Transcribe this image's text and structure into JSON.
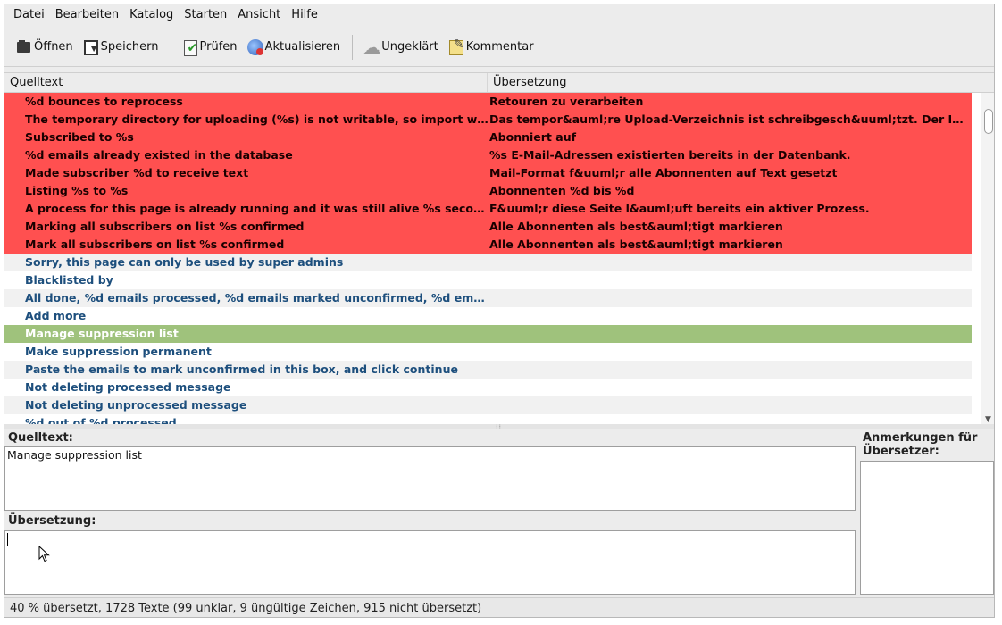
{
  "menubar": {
    "items": [
      "Datei",
      "Bearbeiten",
      "Katalog",
      "Starten",
      "Ansicht",
      "Hilfe"
    ]
  },
  "toolbar": {
    "open_label": "Öffnen",
    "save_label": "Speichern",
    "check_label": "Prüfen",
    "update_label": "Aktualisieren",
    "fuzzy_label": "Ungeklärt",
    "comment_label": "Kommentar"
  },
  "table": {
    "headers": [
      "Quelltext",
      "Übersetzung"
    ],
    "rows": [
      {
        "source": "%d bounces to reprocess",
        "translation": "Retouren zu verarbeiten",
        "state": "red"
      },
      {
        "source": "The temporary directory for uploading (%s) is not writable, so import wil...",
        "translation": "Das tempor&auml;re Upload-Verzeichnis ist schreibgesch&uuml;tzt. Der Im...",
        "state": "red"
      },
      {
        "source": "Subscribed to %s",
        "translation": "Abonniert auf",
        "state": "red"
      },
      {
        "source": "%d emails already existed in the database",
        "translation": "%s E-Mail-Adressen existierten bereits in der Datenbank.",
        "state": "red"
      },
      {
        "source": "Made subscriber %d to receive text",
        "translation": "Mail-Format f&uuml;r alle Abonnenten auf Text gesetzt",
        "state": "red"
      },
      {
        "source": "Listing %s to %s",
        "translation": "Abonnenten %d bis %d",
        "state": "red"
      },
      {
        "source": "A process for this page is already running and it was still alive %s secon...",
        "translation": "F&uuml;r diese Seite l&auml;uft bereits ein aktiver Prozess.",
        "state": "red"
      },
      {
        "source": "Marking all subscribers on list %s confirmed",
        "translation": "Alle Abonnenten als best&auml;tigt markieren",
        "state": "red"
      },
      {
        "source": "Mark all subscribers on list %s confirmed",
        "translation": "Alle Abonnenten als best&auml;tigt markieren",
        "state": "red"
      },
      {
        "source": "Sorry, this page can only be used by super admins",
        "translation": "",
        "state": "alt"
      },
      {
        "source": "Blacklisted by",
        "translation": "",
        "state": "white"
      },
      {
        "source": "All done, %d emails processed, %d emails marked unconfirmed, %d ema...",
        "translation": "",
        "state": "alt"
      },
      {
        "source": "Add more",
        "translation": "",
        "state": "white"
      },
      {
        "source": "Manage suppression list",
        "translation": "",
        "state": "sel"
      },
      {
        "source": "Make suppression permanent",
        "translation": "",
        "state": "white"
      },
      {
        "source": "Paste the emails to mark unconfirmed in this box, and click continue",
        "translation": "",
        "state": "alt"
      },
      {
        "source": "Not deleting processed message",
        "translation": "",
        "state": "white"
      },
      {
        "source": "Not deleting unprocessed message",
        "translation": "",
        "state": "alt"
      },
      {
        "source": "%d out of %d processed",
        "translation": "",
        "state": "white"
      }
    ]
  },
  "editor": {
    "source_label": "Quelltext:",
    "source_text": "Manage suppression list",
    "translation_label": "Übersetzung:",
    "translation_text": "",
    "notes_label": "Anmerkungen für Übersetzer:"
  },
  "status": {
    "text": "40 % übersetzt, 1728 Texte (99 unklar, 9 üngültige Zeichen, 915 nicht übersetzt)"
  },
  "colors": {
    "untranslated_row": "#ff5050",
    "selected_row": "#9fc27c",
    "text_blue": "#1d4f7d"
  }
}
